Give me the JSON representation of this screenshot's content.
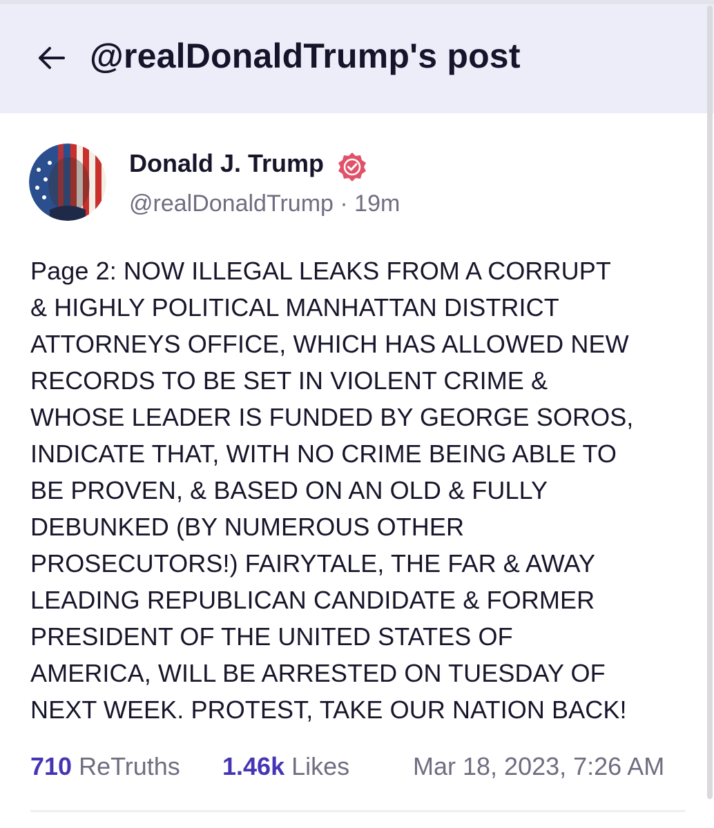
{
  "header": {
    "title": "@realDonaldTrump's post",
    "back_icon": "arrow-left-icon"
  },
  "post": {
    "author": {
      "name": "Donald J. Trump",
      "handle": "@realDonaldTrump",
      "verified_icon": "verified-badge-icon",
      "verified_color": "#e0526a",
      "avatar_icon": "profile-photo"
    },
    "time_ago": "19m",
    "separator": "·",
    "body_lines": [
      "Page 2: NOW ILLEGAL LEAKS FROM A CORRUPT",
      "& HIGHLY POLITICAL MANHATTAN DISTRICT",
      "ATTORNEYS OFFICE, WHICH HAS ALLOWED NEW",
      "RECORDS TO BE SET IN VIOLENT CRIME &",
      "WHOSE LEADER IS FUNDED BY GEORGE SOROS,",
      "INDICATE THAT, WITH NO CRIME BEING ABLE TO",
      "BE PROVEN, & BASED ON AN OLD & FULLY",
      "DEBUNKED (BY NUMEROUS OTHER",
      "PROSECUTORS!) FAIRYTALE, THE FAR & AWAY",
      "LEADING REPUBLICAN CANDIDATE & FORMER",
      "PRESIDENT OF THE UNITED STATES OF",
      "AMERICA, WILL BE ARRESTED ON TUESDAY OF",
      "NEXT WEEK. PROTEST, TAKE OUR NATION BACK!"
    ],
    "stats": {
      "retruths_count": "710",
      "retruths_label": "ReTruths",
      "likes_count": "1.46k",
      "likes_label": "Likes"
    },
    "timestamp": "Mar 18, 2023, 7:26 AM"
  },
  "colors": {
    "header_bg": "#ededf9",
    "accent": "#4535b5",
    "muted_text": "#6f6d80",
    "text": "#17152a"
  }
}
